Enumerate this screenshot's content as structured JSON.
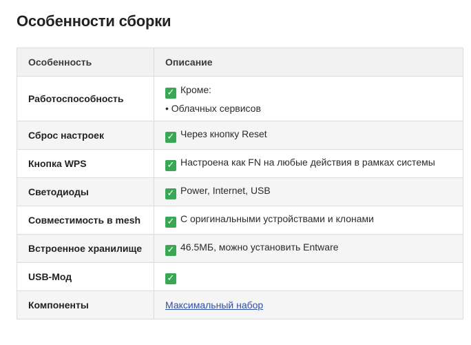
{
  "title": "Особенности сборки",
  "headers": {
    "feature": "Особенность",
    "description": "Описание"
  },
  "check_icon_color": "#3aa757",
  "link_color": "#2f4fa8",
  "rows": [
    {
      "feature": "Работоспособность",
      "description": "Кроме:",
      "sub": "• Облачных сервисов",
      "check": true
    },
    {
      "feature": "Сброс настроек",
      "description": "Через кнопку Reset",
      "check": true
    },
    {
      "feature": "Кнопка WPS",
      "description": "Настроена как FN на любые действия в рамках системы",
      "check": true
    },
    {
      "feature": "Светодиоды",
      "description": "Power, Internet, USB",
      "check": true
    },
    {
      "feature": "Совместимость в mesh",
      "description": "С оригинальными устройствами и клонами",
      "check": true
    },
    {
      "feature": "Встроенное хранилище",
      "description": "46.5МБ, можно установить Entware",
      "check": true
    },
    {
      "feature": "USB-Мод",
      "description": "",
      "check": true
    },
    {
      "feature": "Компоненты",
      "link": "Максимальный набор",
      "check": false
    }
  ]
}
